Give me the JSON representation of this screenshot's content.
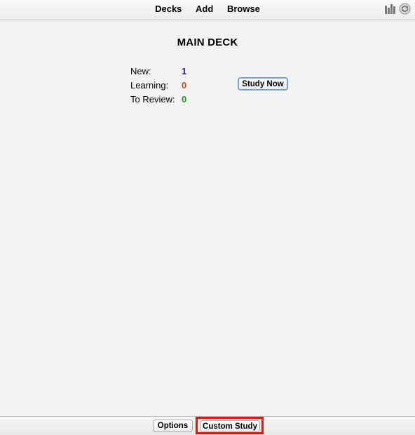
{
  "toolbar": {
    "decks_label": "Decks",
    "add_label": "Add",
    "browse_label": "Browse",
    "icons": [
      "stats-icon",
      "sync-icon"
    ]
  },
  "deck": {
    "title": "MAIN DECK",
    "stats": {
      "new_label": "New:",
      "new_count": "1",
      "learning_label": "Learning:",
      "learning_count": "0",
      "review_label": "To Review:",
      "review_count": "0"
    },
    "study_now_label": "Study Now"
  },
  "bottom": {
    "options_label": "Options",
    "custom_study_label": "Custom Study"
  },
  "colors": {
    "new": "#1a1aa0",
    "learning": "#c0510f",
    "review": "#16a016",
    "highlight": "#e0180a"
  }
}
